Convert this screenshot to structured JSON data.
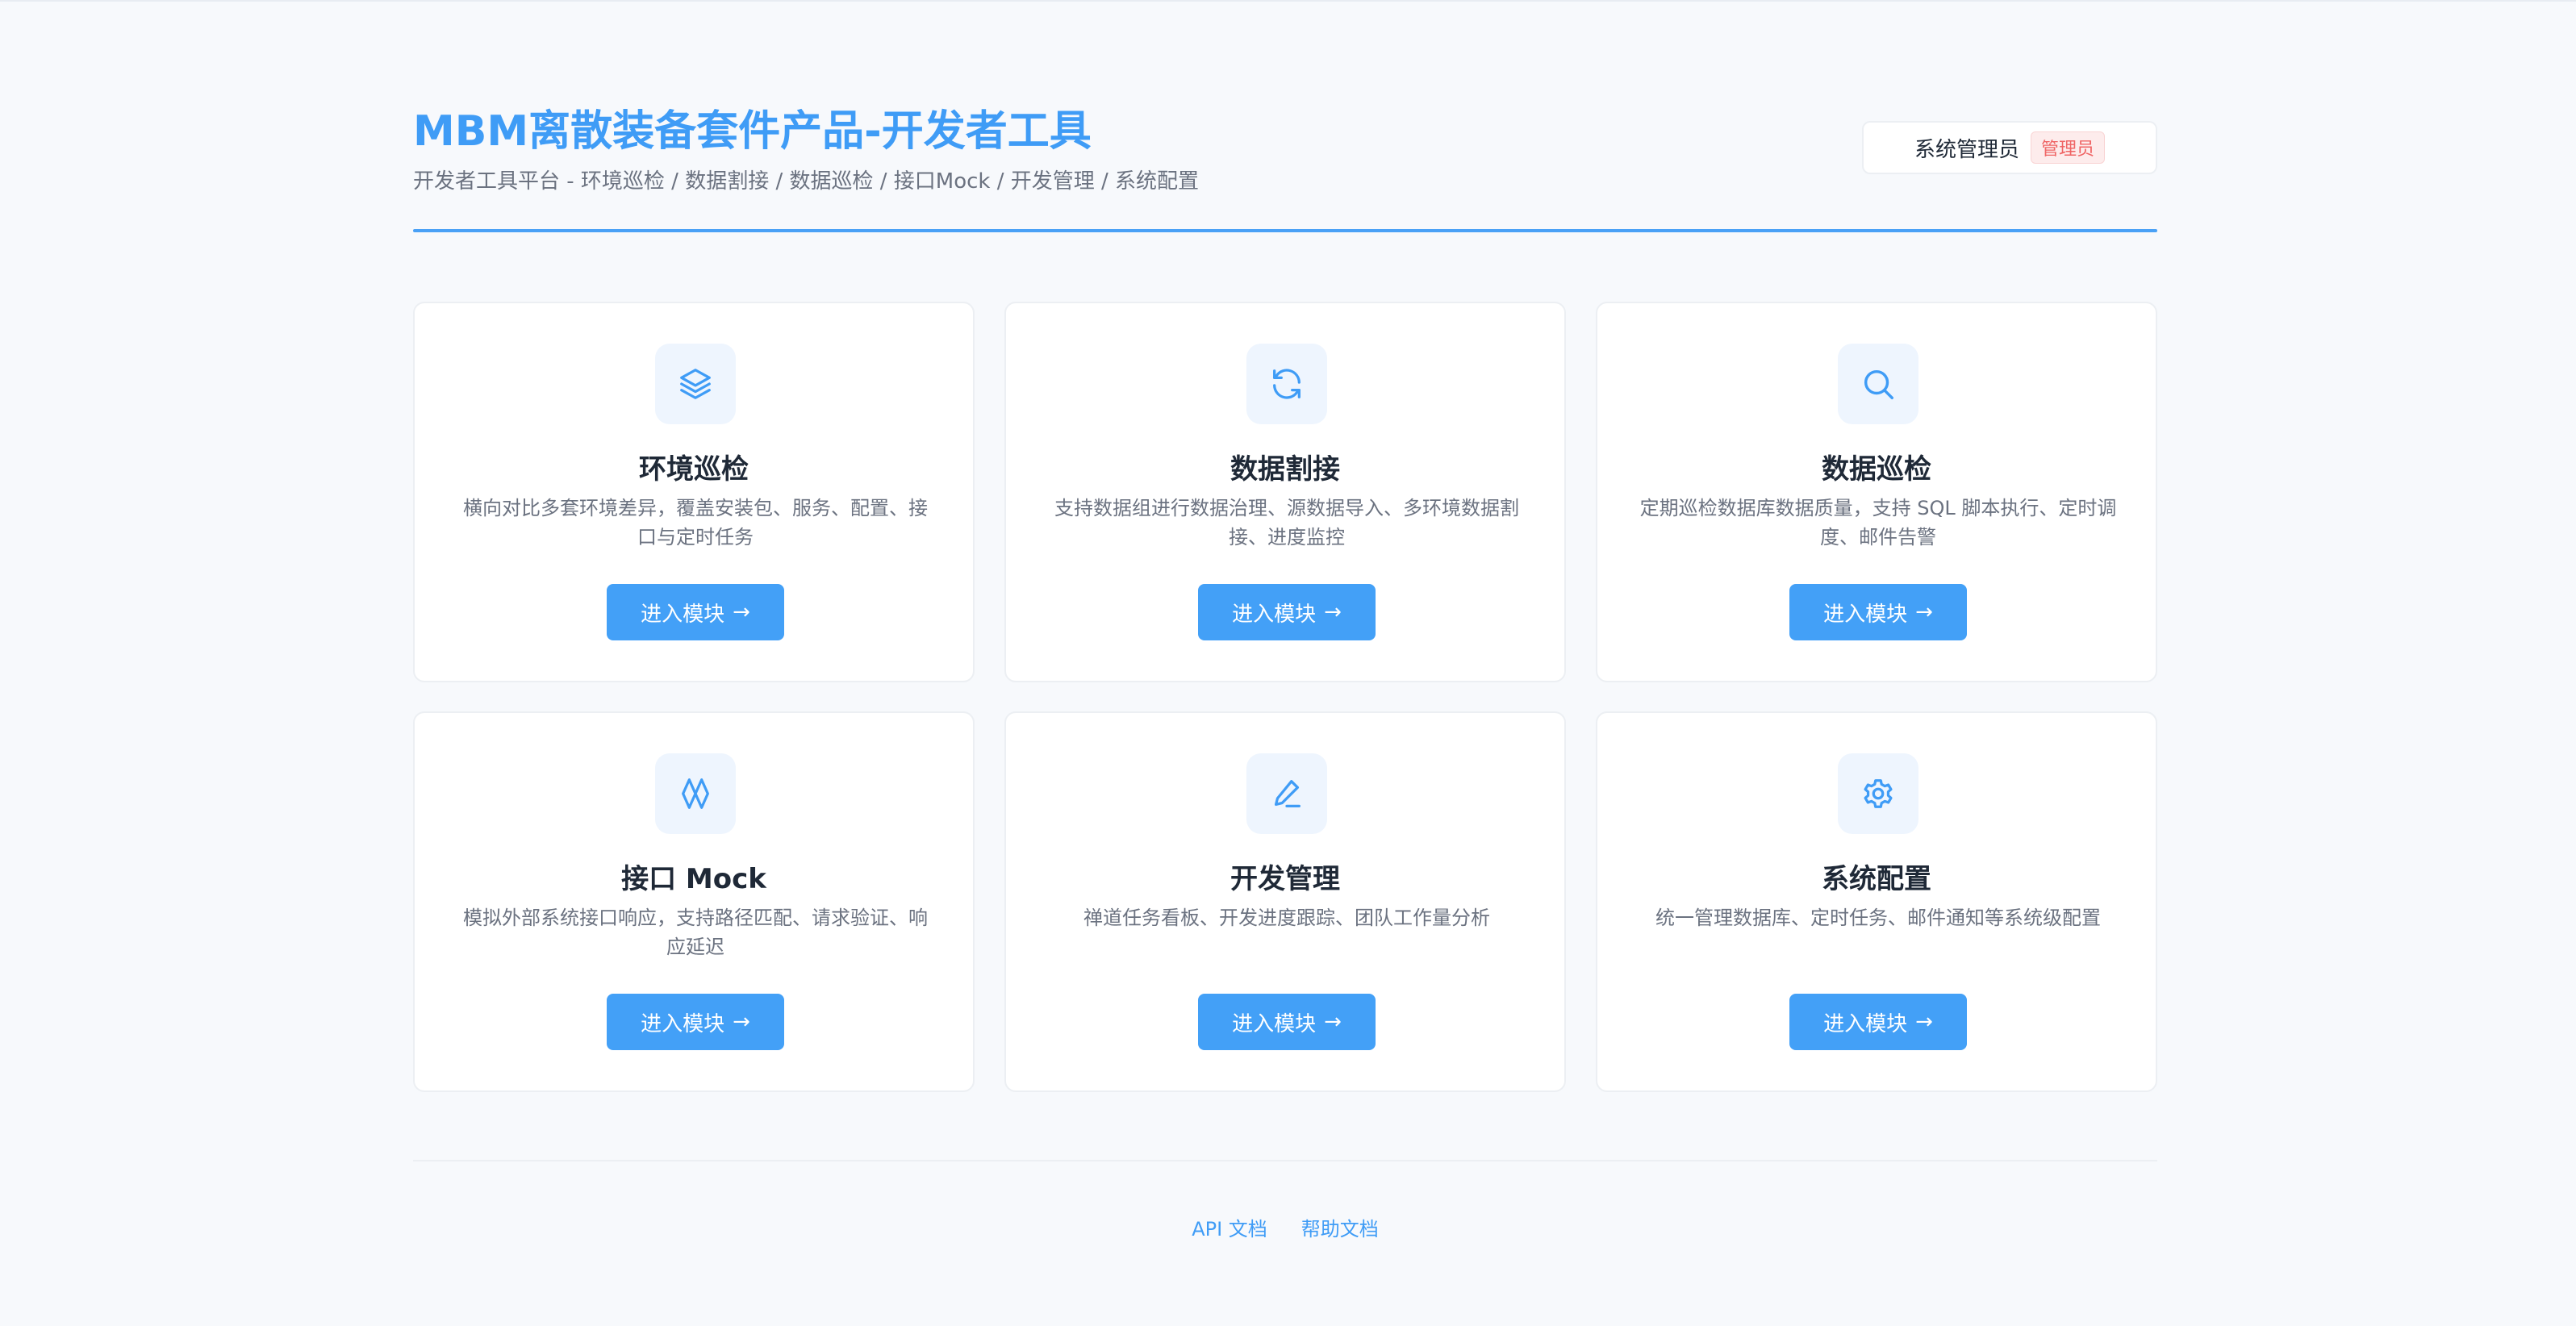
{
  "header": {
    "title": "MBM离散装备套件产品-开发者工具",
    "subtitle": "开发者工具平台 - 环境巡检 / 数据割接 / 数据巡检 / 接口Mock / 开发管理 / 系统配置",
    "user_name": "系统管理员",
    "role_badge": "管理员"
  },
  "modules": [
    {
      "title": "环境巡检",
      "description": "横向对比多套环境差异，覆盖安装包、服务、配置、接口与定时任务",
      "button_label": "进入模块",
      "button_arrow": "→",
      "icon": "layers-icon"
    },
    {
      "title": "数据割接",
      "description": "支持数据组进行数据治理、源数据导入、多环境数据割接、进度监控",
      "button_label": "进入模块",
      "button_arrow": "→",
      "icon": "refresh-icon"
    },
    {
      "title": "数据巡检",
      "description": "定期巡检数据库数据质量，支持 SQL 脚本执行、定时调度、邮件告警",
      "button_label": "进入模块",
      "button_arrow": "→",
      "icon": "search-icon"
    },
    {
      "title": "接口 Mock",
      "description": "模拟外部系统接口响应，支持路径匹配、请求验证、响应延迟",
      "button_label": "进入模块",
      "button_arrow": "→",
      "icon": "mock-icon"
    },
    {
      "title": "开发管理",
      "description": "禅道任务看板、开发进度跟踪、团队工作量分析",
      "button_label": "进入模块",
      "button_arrow": "→",
      "icon": "pen-icon"
    },
    {
      "title": "系统配置",
      "description": "统一管理数据库、定时任务、邮件通知等系统级配置",
      "button_label": "进入模块",
      "button_arrow": "→",
      "icon": "gear-icon"
    }
  ],
  "footer": {
    "api_docs": "API 文档",
    "help_docs": "帮助文档"
  },
  "colors": {
    "accent": "#43a0f7",
    "badge_text": "#ef6464",
    "background": "#f7f9fc"
  }
}
